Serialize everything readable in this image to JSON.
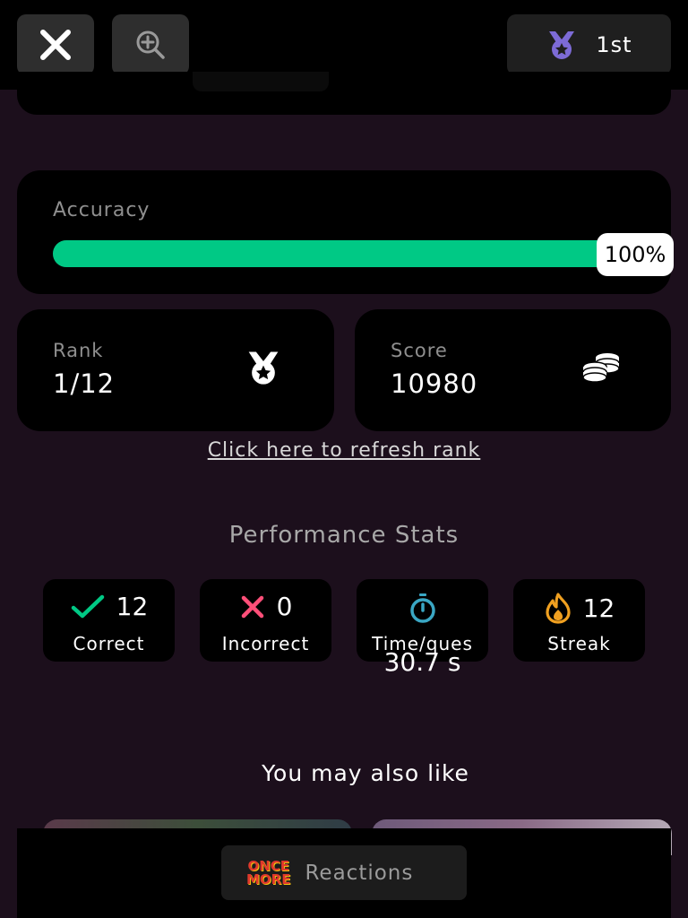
{
  "header": {
    "close_icon": "close-icon",
    "zoom_icon": "zoom-in-icon",
    "rank_badge": "1st",
    "medal_color": "#7d6bd6"
  },
  "accuracy": {
    "label": "Accuracy",
    "percent": 100,
    "percent_text": "100%",
    "bar_color": "#00c985"
  },
  "rank": {
    "label": "Rank",
    "value": "1/12",
    "icon": "medal-icon"
  },
  "score": {
    "label": "Score",
    "value": "10980",
    "icon": "coins-icon"
  },
  "refresh_link": "Click here to refresh rank",
  "performance": {
    "title": "Performance Stats",
    "correct": {
      "value": "12",
      "label": "Correct",
      "color": "#00c985"
    },
    "incorrect": {
      "value": "0",
      "label": "Incorrect",
      "color": "#ff4f79"
    },
    "time": {
      "value": "30.7 s",
      "label": "Time/ques",
      "color": "#3aa7c4"
    },
    "streak": {
      "value": "12",
      "label": "Streak",
      "color": "#f0a020"
    }
  },
  "recommendations": {
    "title": "You may also like"
  },
  "bottom": {
    "logo_text": "ONCE MORE",
    "label": "Reactions"
  }
}
